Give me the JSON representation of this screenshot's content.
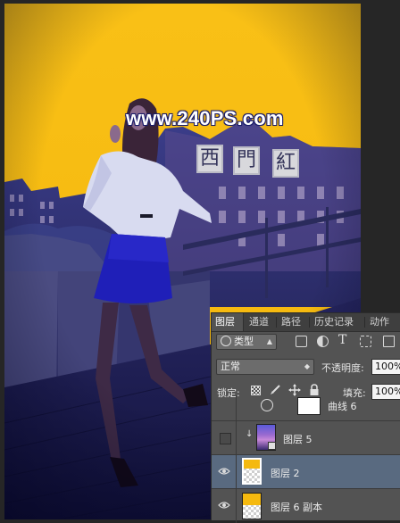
{
  "image": {
    "watermark": "www.240PS.com",
    "sign_chars": [
      "西",
      "門",
      "紅"
    ]
  },
  "panel": {
    "tabs": [
      "图层",
      "通道",
      "路径",
      "历史记录",
      "动作"
    ],
    "active_tab": "图层",
    "filter_kind": "类型",
    "blend_mode": "正常",
    "opacity_label": "不透明度:",
    "opacity_value": "100%",
    "lock_label": "锁定:",
    "fill_label": "填充:",
    "fill_value": "100%",
    "layers": [
      {
        "name": "曲线 6",
        "visible": true
      },
      {
        "name": "图层 5",
        "visible": false,
        "clipped": true,
        "smart_object": true
      },
      {
        "name": "图层 2",
        "visible": true,
        "selected": true
      },
      {
        "name": "图层 6 副本",
        "visible": true
      }
    ]
  },
  "colors": {
    "background_yellow": "#f9bf14",
    "panel_bg": "#535353",
    "selection": "#596a80",
    "photo_tint": "#2a2a78"
  },
  "icons": {
    "eye": "eye-icon",
    "lock_transparent": "checkerboard-lock-icon",
    "lock_paint": "brush-lock-icon",
    "lock_move": "move-lock-icon",
    "lock_all": "padlock-icon",
    "filter_pixel": "image-filter-icon",
    "filter_adjust": "adjustment-filter-icon",
    "filter_text": "text-filter-icon",
    "filter_shape": "shape-filter-icon",
    "filter_smart": "smart-object-filter-icon"
  }
}
